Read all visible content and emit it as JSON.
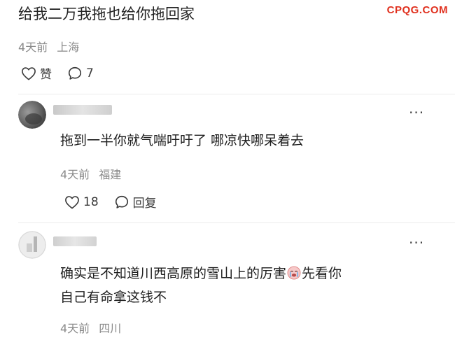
{
  "watermark": "CPQG.COM",
  "top_comment": {
    "text": "给我二万我拖也给你拖回家",
    "time": "4天前",
    "location": "上海",
    "like_label": "赞",
    "reply_count": "7"
  },
  "replies": [
    {
      "text": "拖到一半你就气喘吁吁了 哪凉快哪呆着去",
      "time": "4天前",
      "location": "福建",
      "like_count": "18",
      "reply_label": "回复"
    },
    {
      "text_line1": "确实是不知道川西高原的雪山上的厉害",
      "emoji": "crying-face-emoji",
      "text_line1_after": "先看你",
      "text_line2": "自己有命拿这钱不",
      "time": "4天前",
      "location": "四川"
    }
  ],
  "icons": {
    "like": "heart-outline-icon",
    "comment": "speech-bubble-icon",
    "more": "more-dots-icon"
  },
  "colors": {
    "watermark": "#e0301e",
    "text": "#1e1e1e",
    "meta": "#8a8a8a"
  }
}
